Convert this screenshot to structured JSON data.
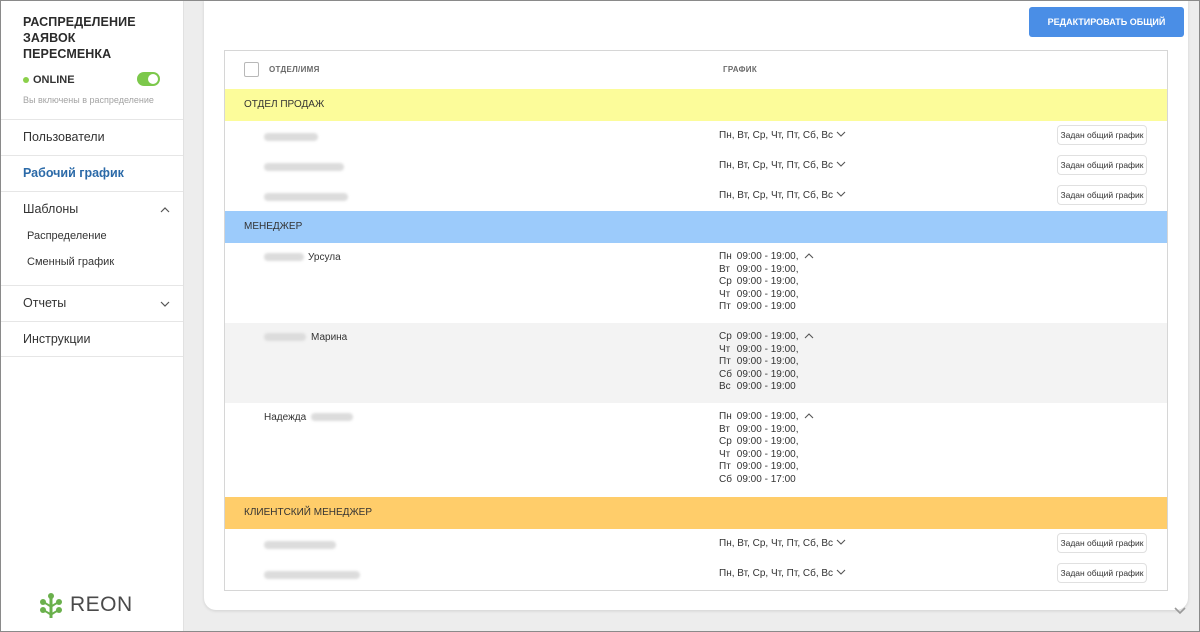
{
  "sidebar": {
    "title": "РАСПРЕДЕЛЕНИЕ ЗАЯВОК ПЕРЕСМЕНКА",
    "status_label": "ONLINE",
    "status_sub": "Вы включены в распределение",
    "toggle_on": true,
    "nav": {
      "users": "Пользователи",
      "schedule": "Рабочий график",
      "templates": "Шаблоны",
      "templates_sub": [
        "Распределение",
        "Сменный график"
      ],
      "reports": "Отчеты",
      "instructions": "Инструкции"
    },
    "logo_text": "REON"
  },
  "main": {
    "edit_button": "РЕДАКТИРОВАТЬ ОБЩИЙ ГРАФИК",
    "columns": {
      "name": "ОТДЕЛ/ИМЯ",
      "schedule": "ГРАФИК"
    },
    "badge_text": "Задан общий график",
    "short_schedule": "Пн, Вт, Ср, Чт, Пт, Сб, Вс",
    "groups": {
      "sales": {
        "name": "ОТДЕЛ ПРОДАЖ",
        "color": "#fcfc9a"
      },
      "manager": {
        "name": "МЕНЕДЖЕР",
        "color": "#9ccbfb",
        "people": [
          {
            "name": "Урсула",
            "days": [
              [
                "Пн",
                "09:00 - 19:00,"
              ],
              [
                "Вт",
                "09:00 - 19:00,"
              ],
              [
                "Ср",
                "09:00 - 19:00,"
              ],
              [
                "Чт",
                "09:00 - 19:00,"
              ],
              [
                "Пт",
                "09:00 - 19:00"
              ]
            ]
          },
          {
            "name": "Марина",
            "days": [
              [
                "Ср",
                "09:00 - 19:00,"
              ],
              [
                "Чт",
                "09:00 - 19:00,"
              ],
              [
                "Пт",
                "09:00 - 19:00,"
              ],
              [
                "Сб",
                "09:00 - 19:00,"
              ],
              [
                "Вс",
                "09:00 - 19:00"
              ]
            ]
          },
          {
            "name": "Надежда",
            "days": [
              [
                "Пн",
                "09:00 - 19:00,"
              ],
              [
                "Вт",
                "09:00 - 19:00,"
              ],
              [
                "Ср",
                "09:00 - 19:00,"
              ],
              [
                "Чт",
                "09:00 - 19:00,"
              ],
              [
                "Пт",
                "09:00 - 19:00,"
              ],
              [
                "Сб",
                "09:00 - 17:00"
              ]
            ]
          }
        ]
      },
      "client": {
        "name": "КЛИЕНТСКИЙ МЕНЕДЖЕР",
        "color": "#ffcd6a"
      }
    }
  }
}
